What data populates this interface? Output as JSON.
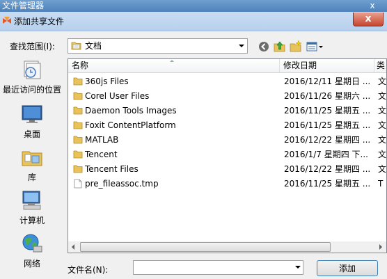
{
  "outer_window": {
    "title": "文件管理器"
  },
  "dialog": {
    "title": "添加共享文件"
  },
  "look_in": {
    "label": "查找范围(I):",
    "value": "文档"
  },
  "places": [
    {
      "label": "最近访问的位置",
      "icon": "recent-places-icon"
    },
    {
      "label": "桌面",
      "icon": "desktop-icon"
    },
    {
      "label": "库",
      "icon": "libraries-icon"
    },
    {
      "label": "计算机",
      "icon": "computer-icon"
    },
    {
      "label": "网络",
      "icon": "network-icon"
    }
  ],
  "columns": {
    "name": "名称",
    "date": "修改日期",
    "more": "类"
  },
  "files": [
    {
      "name": "360js Files",
      "date": "2016/12/11 星期日 ...",
      "overflow": "文",
      "type": "folder"
    },
    {
      "name": "Corel User Files",
      "date": "2016/11/26 星期六 ...",
      "overflow": "文",
      "type": "folder"
    },
    {
      "name": "Daemon Tools Images",
      "date": "2016/11/25 星期五 ...",
      "overflow": "文",
      "type": "folder"
    },
    {
      "name": "Foxit ContentPlatform",
      "date": "2016/11/25 星期五 ...",
      "overflow": "文",
      "type": "folder"
    },
    {
      "name": "MATLAB",
      "date": "2016/12/22 星期四 ...",
      "overflow": "文",
      "type": "folder"
    },
    {
      "name": "Tencent",
      "date": "2016/1/7 星期四 下...",
      "overflow": "文",
      "type": "folder"
    },
    {
      "name": "Tencent Files",
      "date": "2016/12/22 星期四 ...",
      "overflow": "文",
      "type": "folder"
    },
    {
      "name": "pre_fileassoc.tmp",
      "date": "2016/11/25 星期五 ...",
      "overflow": "T",
      "type": "file"
    }
  ],
  "filename": {
    "label": "文件名(N):",
    "value": ""
  },
  "buttons": {
    "add": "添加",
    "close": "x"
  },
  "colors": {
    "title_bar": "#b7d0ec",
    "close_button": "#c7452e",
    "folder": "#e8c25a"
  }
}
